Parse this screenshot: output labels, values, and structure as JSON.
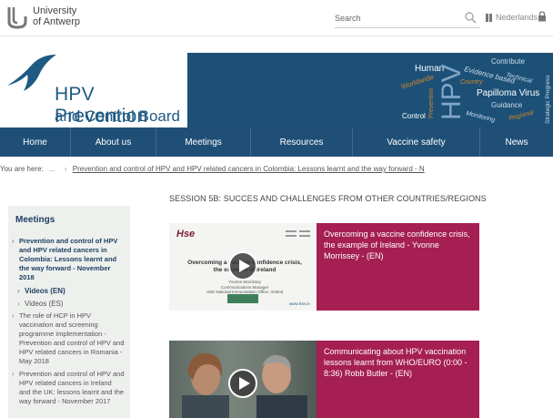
{
  "header": {
    "university_line1": "University",
    "university_line2": "of Antwerp",
    "search_placeholder": "Search",
    "language_link": "Nederlands"
  },
  "brand": {
    "line1": "HPV Prevention",
    "line2": "and Control Board",
    "banner_words": {
      "human": "Human",
      "hpv": "HPV",
      "contribute": "Contribute",
      "evidence_based": "Evidence based",
      "technical": "Technical",
      "country": "Country",
      "worldwide": "Worldwide",
      "papilloma": "Papilloma Virus",
      "guidance": "Guidance",
      "prevention": "Prevention",
      "monitoring": "Monitoring",
      "regional": "Regional",
      "strategic_progress": "Strategic Progress",
      "control": "Control"
    }
  },
  "nav": {
    "items": [
      {
        "label": "Home"
      },
      {
        "label": "About us"
      },
      {
        "label": "Meetings"
      },
      {
        "label": "Resources"
      },
      {
        "label": "Vaccine safety"
      },
      {
        "label": "News"
      }
    ]
  },
  "breadcrumb": {
    "prefix": "You are here:",
    "ellipsis": "...",
    "current": "Prevention and control of HPV and HPV related cancers in Colombia: Lessons learnt and the way forward - N"
  },
  "sidebar": {
    "title": "Meetings",
    "items": [
      {
        "label": "Prevention and control of HPV and HPV related cancers in Colombia: Lessons learnt and the way forward - November 2018"
      },
      {
        "label": "The role of HCP in HPV vaccination and screening programme implementation - Prevention and control of HPV and HPV related cancers in Romania - May 2018"
      },
      {
        "label": "Prevention and control of HPV and HPV related cancers in Ireland and the UK: lessons learnt and the way forward - November 2017"
      }
    ],
    "subitems": [
      {
        "label": "Videos (EN)"
      },
      {
        "label": "Videos (ES)"
      }
    ]
  },
  "main": {
    "session_title": "SESSION 5B: SUCCES AND CHALLENGES FROM OTHER COUNTRIES/REGIONS",
    "videos": [
      {
        "title": "Overcoming a vaccine confidence crisis, the example of Ireland - Yvonne Morrissey - (EN)",
        "slide_logo": "Hse",
        "slide_heading": "Overcoming a vaccine confidence crisis, the example of Ireland",
        "slide_author_1": "Yvonne Morrissey",
        "slide_author_2": "Communications Manager",
        "slide_author_3": "HSE National Immunisation Office, Ireland",
        "slide_footer": "www.hse.ie"
      },
      {
        "title": "Communicating about HPV vaccination lessons learnt from WHO/EURO (0:00 - 8:36) Robb Butler - (EN)"
      }
    ]
  },
  "colors": {
    "nav_bg": "#1f4f77",
    "banner_bg": "#1c5077",
    "brand_blue": "#1e5a83",
    "card_magenta": "#a51f52",
    "sidebar_bg": "#eef0ee"
  }
}
